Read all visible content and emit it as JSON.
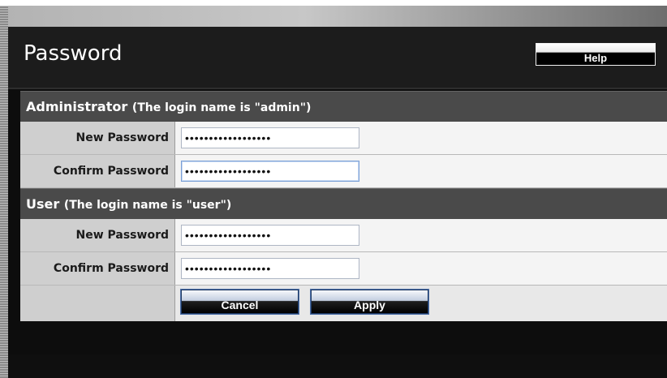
{
  "header": {
    "title": "Password",
    "help_label": "Help"
  },
  "admin_section": {
    "title": "Administrator",
    "note": "(The login name is \"admin\")",
    "new_password_label": "New Password",
    "new_password_value": "••••••••••••••••••",
    "confirm_password_label": "Confirm Password",
    "confirm_password_value": "••••••••••••••••••"
  },
  "user_section": {
    "title": "User",
    "note": "(The login name is \"user\")",
    "new_password_label": "New Password",
    "new_password_value": "••••••••••••••••••",
    "confirm_password_label": "Confirm Password",
    "confirm_password_value": "••••••••••••••••••"
  },
  "actions": {
    "cancel_label": "Cancel",
    "apply_label": "Apply"
  },
  "colors": {
    "title_bar": "#1c1c1c",
    "section_header": "#4a4a4a",
    "label_cell": "#cfcfcf",
    "field_focus_border": "#7a9fd6"
  }
}
